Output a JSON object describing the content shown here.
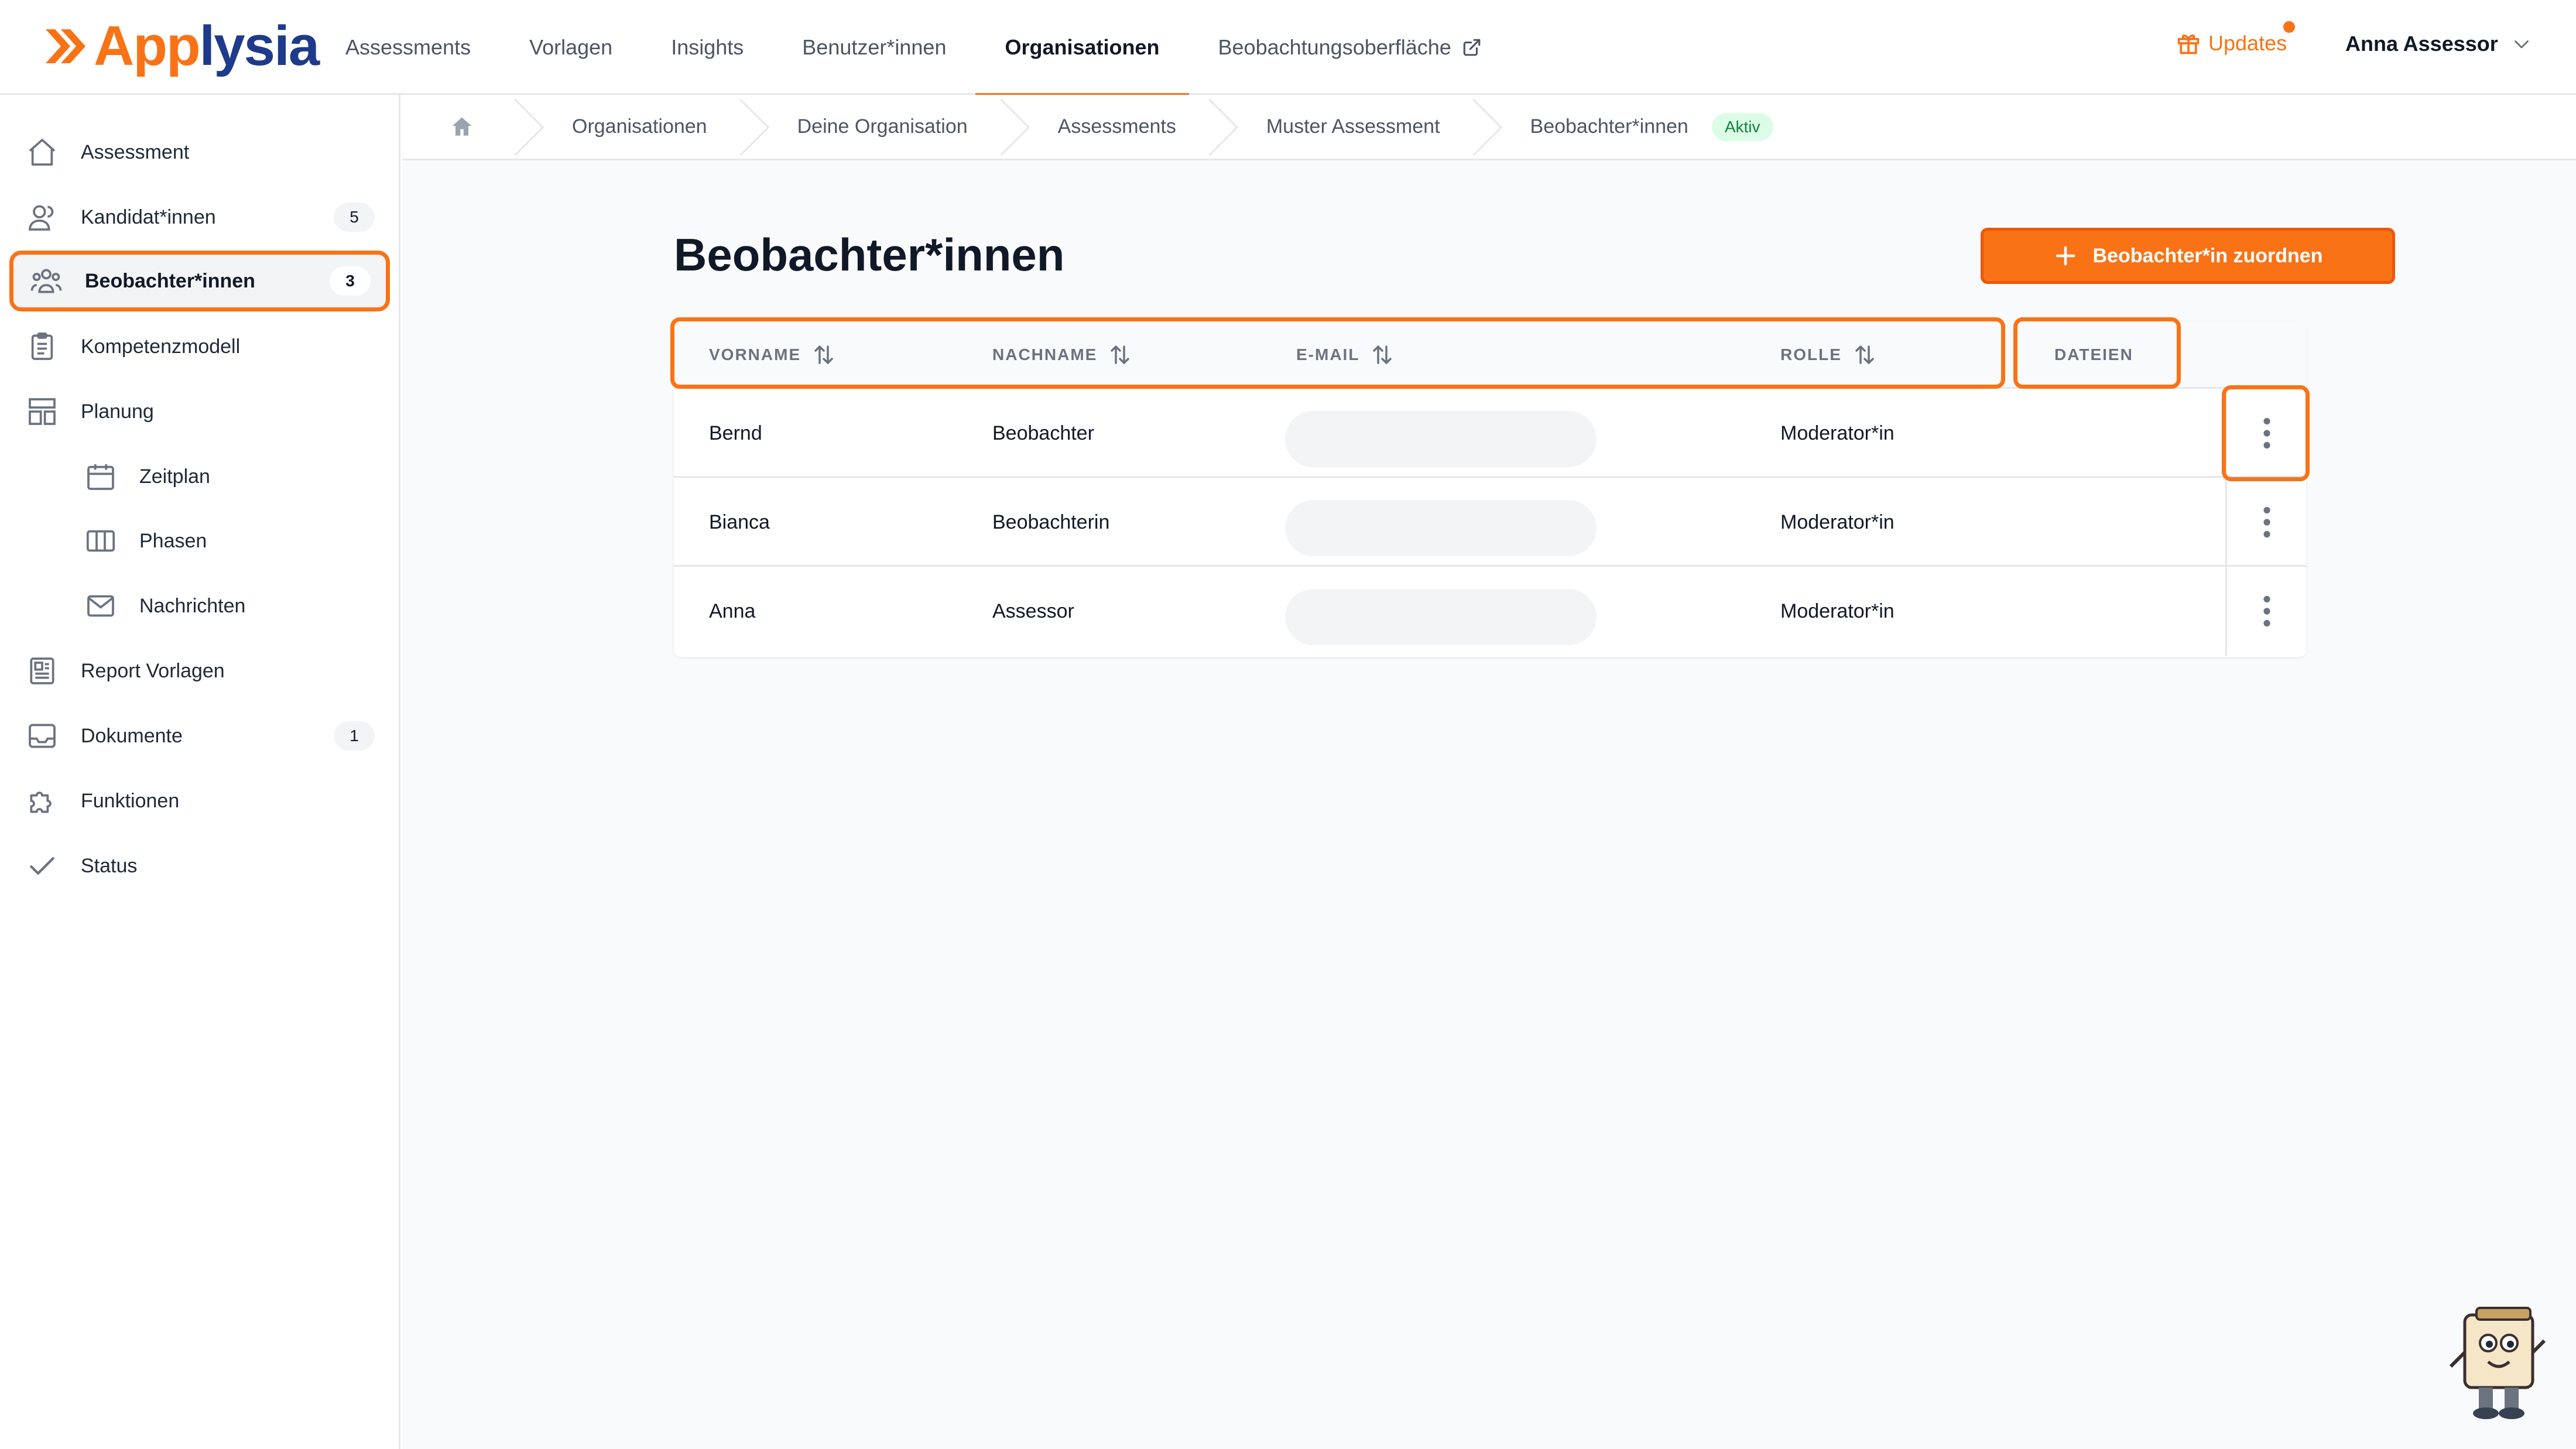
{
  "brand": {
    "logo_part1": "App",
    "logo_part2": "lysia"
  },
  "topnav": [
    {
      "label": "Assessments",
      "active": false
    },
    {
      "label": "Vorlagen",
      "active": false
    },
    {
      "label": "Insights",
      "active": false
    },
    {
      "label": "Benutzer*innen",
      "active": false
    },
    {
      "label": "Organisationen",
      "active": true
    },
    {
      "label": "Beobachtungsoberfläche",
      "active": false,
      "icon": "external-link-icon"
    }
  ],
  "header": {
    "updates_label": "Updates",
    "user_name": "Anna Assessor"
  },
  "sidebar": {
    "items": [
      {
        "label": "Assessment",
        "icon": "home-icon"
      },
      {
        "label": "Kandidat*innen",
        "icon": "users-icon",
        "count": "5"
      },
      {
        "label": "Beobachter*innen",
        "icon": "group-icon",
        "count": "3",
        "active": true
      },
      {
        "label": "Kompetenzmodell",
        "icon": "clipboard-icon"
      },
      {
        "label": "Planung",
        "icon": "layout-icon"
      },
      {
        "label": "Zeitplan",
        "icon": "calendar-icon",
        "sub": true
      },
      {
        "label": "Phasen",
        "icon": "columns-icon",
        "sub": true
      },
      {
        "label": "Nachrichten",
        "icon": "mail-icon",
        "sub": true
      },
      {
        "label": "Report Vorlagen",
        "icon": "report-icon"
      },
      {
        "label": "Dokumente",
        "icon": "inbox-icon",
        "count": "1"
      },
      {
        "label": "Funktionen",
        "icon": "puzzle-icon"
      },
      {
        "label": "Status",
        "icon": "check-icon"
      }
    ]
  },
  "breadcrumb": {
    "items": [
      "Organisationen",
      "Deine Organisation",
      "Assessments",
      "Muster Assessment",
      "Beobachter*innen"
    ],
    "badge": "Aktiv"
  },
  "page": {
    "title": "Beobachter*innen",
    "add_button": "Beobachter*in zuordnen"
  },
  "table": {
    "columns": [
      "VORNAME",
      "NACHNAME",
      "E-MAIL",
      "ROLLE",
      "DATEIEN"
    ],
    "rows": [
      {
        "vorname": "Bernd",
        "nachname": "Beobachter",
        "email": "",
        "rolle": "Moderator*in"
      },
      {
        "vorname": "Bianca",
        "nachname": "Beobachterin",
        "email": "",
        "rolle": "Moderator*in"
      },
      {
        "vorname": "Anna",
        "nachname": "Assessor",
        "email": "",
        "rolle": "Moderator*in"
      }
    ]
  },
  "colors": {
    "accent": "#f97316",
    "brand_blue": "#1e3a8a",
    "badge_green_bg": "#dcfce7",
    "badge_green_text": "#15803d"
  }
}
